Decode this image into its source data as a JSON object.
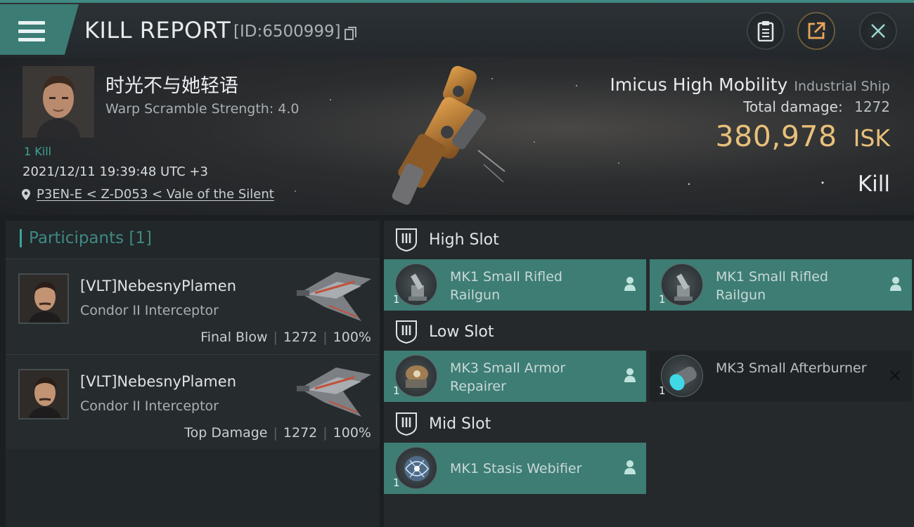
{
  "header": {
    "title": "KILL REPORT",
    "report_id": "[ID:6500999]",
    "icons": [
      "menu-icon",
      "copy-icon",
      "clipboard-icon",
      "share-icon",
      "close-icon"
    ]
  },
  "victim": {
    "pilot_name": "时光不与她轻语",
    "warp_scramble": "Warp Scramble Strength: 4.0",
    "kill_count": "1 Kill",
    "datetime": "2021/12/11 19:39:48 UTC +3",
    "location": "P3EN-E < Z-D053 < Vale of the Silent",
    "ship_name": "Imicus High Mobility",
    "ship_class": "Industrial Ship",
    "total_damage_label": "Total damage:",
    "total_damage": "1272",
    "isk_value": "380,978",
    "isk_unit": "ISK",
    "result": "Kill"
  },
  "participants": {
    "label": "Participants [1]",
    "rows": [
      {
        "name": "[VLT]NebesnyPlamen",
        "ship": "Condor II Interceptor",
        "role": "Final Blow",
        "damage": "1272",
        "percent": "100%"
      },
      {
        "name": "[VLT]NebesnyPlamen",
        "ship": "Condor II Interceptor",
        "role": "Top Damage",
        "damage": "1272",
        "percent": "100%"
      }
    ]
  },
  "slots": {
    "high": {
      "label": "High Slot",
      "modules": [
        {
          "name": "MK1 Small Rifled Railgun",
          "qty": "1",
          "state": "fitted"
        },
        {
          "name": "MK1 Small Rifled Railgun",
          "qty": "1",
          "state": "fitted"
        }
      ]
    },
    "low": {
      "label": "Low Slot",
      "modules": [
        {
          "name": "MK3 Small Armor Repairer",
          "qty": "1",
          "state": "fitted"
        },
        {
          "name": "MK3 Small Afterburner",
          "qty": "1",
          "state": "destroyed"
        }
      ]
    },
    "mid": {
      "label": "Mid Slot",
      "modules": [
        {
          "name": "MK1 Stasis Webifier",
          "qty": "1",
          "state": "fitted"
        }
      ]
    }
  },
  "colors": {
    "accent_teal": "#3d7d74",
    "isk_gold": "#e8c07a",
    "kill_teal": "#3ea39a"
  }
}
